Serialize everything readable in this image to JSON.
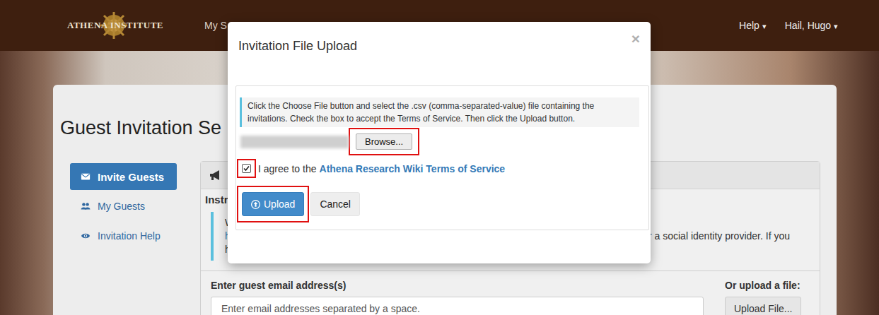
{
  "navbar": {
    "logo": "ATHENA INSTITUTE",
    "items": [
      {
        "label": "My S"
      }
    ],
    "menus": [
      {
        "label": "Help",
        "caret": "▾"
      },
      {
        "label": "Hail, Hugo",
        "caret": "▾"
      }
    ]
  },
  "page": {
    "title": "Guest Invitation Se",
    "sidebar": [
      {
        "label": "Invite Guests",
        "icon": "envelope",
        "selected": true
      },
      {
        "label": "My Guests",
        "icon": "users",
        "selected": false
      },
      {
        "label": "Invitation Help",
        "icon": "eye",
        "selected": false
      }
    ],
    "panel": {
      "heading": "Instr",
      "lines": [
        {
          "text": "W",
          "link": false
        },
        {
          "text": "h",
          "link": true,
          "tail": "r a social identity provider. If you"
        },
        {
          "text": "h",
          "link": false
        }
      ]
    },
    "form": {
      "email_label": "Enter guest email address(s)",
      "email_placeholder": "Enter email addresses separated by a space.",
      "upload_label": "Or upload a file:",
      "upload_button": "Upload File..."
    }
  },
  "dialog": {
    "title": "Invitation File Upload",
    "close": "×",
    "instructions": "Click the Choose File button and select the .csv (comma-separated-value) file containing the invitations. Check the box to accept the Terms of Service. Then click the Upload button.",
    "file": {
      "browse": "Browse...",
      "highlighted": true
    },
    "terms": {
      "checked": true,
      "highlighted": true,
      "prefix": "I agree to the",
      "link": "Athena Research Wiki Terms of Service"
    },
    "buttons": [
      {
        "label": "Upload",
        "kind": "primary",
        "highlighted": true
      },
      {
        "label": "Cancel",
        "kind": "default",
        "highlighted": false
      }
    ]
  }
}
